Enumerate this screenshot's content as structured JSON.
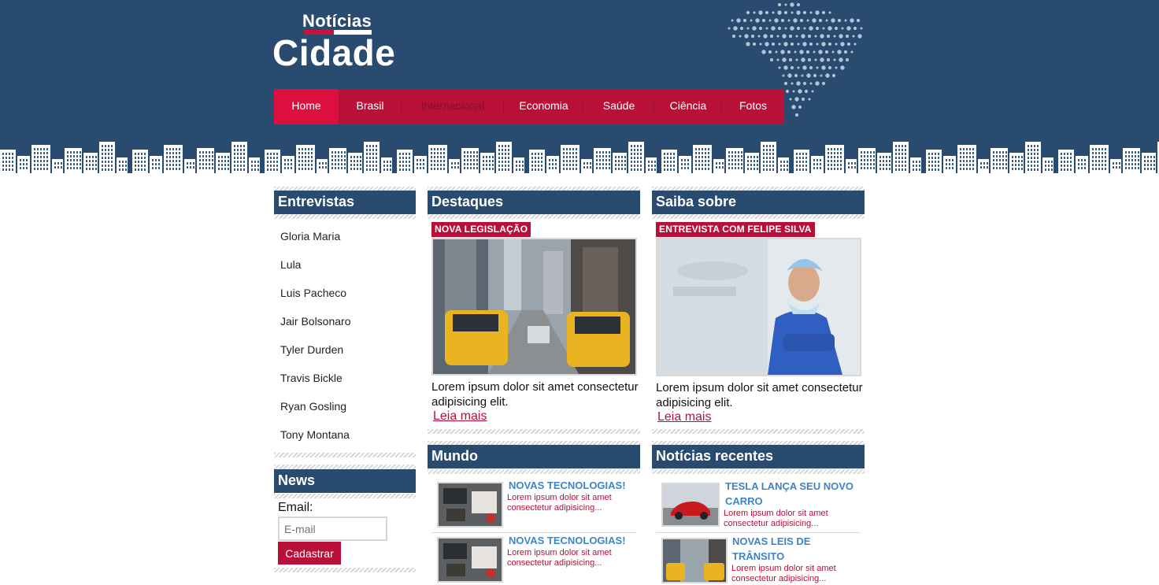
{
  "logo": {
    "top": "Notícias",
    "main": "Cidade"
  },
  "nav": [
    {
      "label": "Home",
      "state": "active"
    },
    {
      "label": "Brasil",
      "state": "normal"
    },
    {
      "label": "Internacional",
      "state": "dim"
    },
    {
      "label": "Economia",
      "state": "normal"
    },
    {
      "label": "Saúde",
      "state": "normal"
    },
    {
      "label": "Ciência",
      "state": "normal"
    },
    {
      "label": "Fotos",
      "state": "normal"
    }
  ],
  "entrevistas": {
    "title": "Entrevistas",
    "items": [
      "Gloria Maria",
      "Lula",
      "Luis Pacheco",
      "Jair Bolsonaro",
      "Tyler Durden",
      "Travis Bickle",
      "Ryan Gosling",
      "Tony Montana"
    ]
  },
  "news": {
    "title": "News",
    "email_label": "Email:",
    "email_placeholder": "E-mail",
    "submit_label": "Cadastrar"
  },
  "destaques": {
    "title": "Destaques",
    "tag": "NOVA LEGISLAÇÃO",
    "text": "Lorem ipsum dolor sit amet consectetur adipisicing elit.",
    "link": "Leia mais"
  },
  "saiba": {
    "title": "Saiba sobre",
    "tag": "ENTREVISTA COM FELIPE SILVA",
    "text": "Lorem ipsum dolor sit amet consectetur adipisicing elit.",
    "link": "Leia mais"
  },
  "mundo": {
    "title": "Mundo",
    "items": [
      {
        "title": "NOVAS TECNOLOGIAS!",
        "text": "Lorem ipsum dolor sit amet consectetur adipisicing..."
      },
      {
        "title": "NOVAS TECNOLOGIAS!",
        "text": "Lorem ipsum dolor sit amet consectetur adipisicing..."
      }
    ]
  },
  "recentes": {
    "title": "Notícias recentes",
    "items": [
      {
        "title": "TESLA LANÇA SEU NOVO CARRO",
        "text": "Lorem ipsum dolor sit amet consectetur adipisicing..."
      },
      {
        "title": "NOVAS LEIS DE TRÂNSITO",
        "text": "Lorem ipsum dolor sit amet consectetur adipisicing..."
      }
    ]
  },
  "colors": {
    "navy": "#2a4b70",
    "crimson": "#b81038",
    "active_red": "#dc0f3f",
    "link_blue": "#3f84c5"
  },
  "icons": [
    "brazil-map-icon",
    "city-skyline-icon"
  ]
}
